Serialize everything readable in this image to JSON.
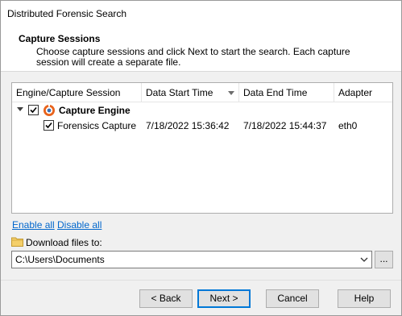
{
  "window": {
    "title": "Distributed Forensic Search"
  },
  "header": {
    "title": "Capture Sessions",
    "description": "Choose capture sessions and click Next to start the search. Each capture session will create a separate file."
  },
  "table": {
    "columns": [
      "Engine/Capture Session",
      "Data Start Time",
      "Data End Time",
      "Adapter"
    ],
    "sorted_column": "Data Start Time",
    "group": {
      "label": "Capture Engine",
      "checked": true,
      "expanded": true
    },
    "rows": [
      {
        "session": "Forensics Capture",
        "start": "7/18/2022 15:36:42",
        "end": "7/18/2022 15:44:37",
        "adapter": "eth0",
        "checked": true
      }
    ]
  },
  "links": {
    "enable_all": "Enable all",
    "disable_all": "Disable all"
  },
  "download": {
    "label": "Download files to:",
    "path": "C:\\Users\\Documents",
    "browse_label": "..."
  },
  "buttons": {
    "back": "< Back",
    "next": "Next >",
    "cancel": "Cancel",
    "help": "Help"
  },
  "colors": {
    "link": "#0066cc",
    "primary_border": "#0078d7",
    "engine_icon": "#e8631c"
  }
}
